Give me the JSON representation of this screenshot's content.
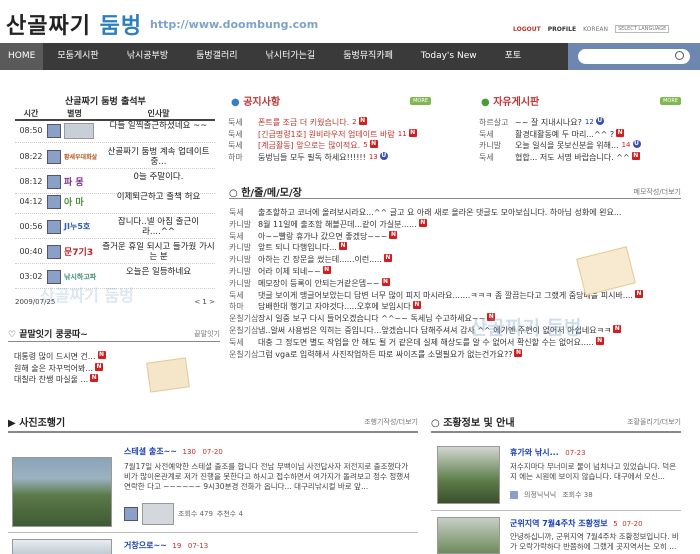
{
  "header": {
    "logo_main": "산골짜기",
    "logo_sub": "둠벙",
    "url": "http://www.doombung.com",
    "menu": {
      "logout": "LOGOUT",
      "profile": "PROFILE",
      "lang": "KOREAN",
      "select": "SELECT LANGUAGE"
    }
  },
  "nav": {
    "items": [
      "HOME",
      "모둠게시판",
      "낚시공부방",
      "둠벙갤러리",
      "낚시터가는길",
      "둠벙뮤직카페",
      "Today's New",
      "포토"
    ]
  },
  "attendance": {
    "title": "산골짜기 둠벙 출석부",
    "headers": {
      "time": "시간",
      "nick": "별명",
      "greet": "인사말"
    },
    "rows": [
      {
        "time": "08:50",
        "nick": "",
        "msg": "다들 일찍출근하셨네요 ~~"
      },
      {
        "time": "08:22",
        "nick": "황새우대화살",
        "msg": "산골짜기 둠벙 계속 업데이트중..."
      },
      {
        "time": "08:12",
        "nick": "파 몽",
        "msg": "0늘 주말이다."
      },
      {
        "time": "04:12",
        "nick": "아 마",
        "msg": "이제퇴근하고 출책 허요"
      },
      {
        "time": "00:56",
        "nick": "JI누5호",
        "msg": "잡니다..넬 아침 출근이라....^^"
      },
      {
        "time": "00:40",
        "nick": "문7기3",
        "msg": "즐거운 휴일 되시고 들가웠 가시는 분"
      },
      {
        "time": "03:02",
        "nick": "낚시하고파",
        "msg": "오늘은 일등하네요"
      }
    ],
    "date": "2009/07/25",
    "pager_prev": "<",
    "pager_next": ">",
    "pager_num": "1"
  },
  "notice": {
    "title": "공지사항",
    "more": "MORE",
    "rows": [
      {
        "cat": "둑세",
        "text": "폰트를 조금 더 키웠습니다.",
        "count": "2",
        "badge": "N"
      },
      {
        "cat": "둑세",
        "text": "[긴급명령1호] 원비라우저 업데이트 바람",
        "count": "11",
        "badge": "N"
      },
      {
        "cat": "둑세",
        "text": "[계금활동] 앞으로는 많이적요.",
        "count": "5",
        "badge": "N"
      },
      {
        "cat": "하마",
        "text": "둠벙님들 모두 필독 하세요!!!!!!",
        "count": "13",
        "badge": "U"
      }
    ]
  },
  "free": {
    "title": "자유게시판",
    "more": "MORE",
    "rows": [
      {
        "cat": "하르살고",
        "text": "~~ 잘 지내시나요?",
        "count": "12",
        "badge": "U"
      },
      {
        "cat": "둑세",
        "text": "활경대활동예 두 마리...^^ ?",
        "count": "",
        "badge": "N"
      },
      {
        "cat": "카니발",
        "text": "오늘 일식을 못보신분을 위해...",
        "count": "14",
        "badge": "U"
      },
      {
        "cat": "둑세",
        "text": "협합... 저도 서명 바랍습니다. ^^",
        "count": "",
        "badge": "N"
      }
    ]
  },
  "memo": {
    "title": "한/줄/메/모/장",
    "link": "메모작성/더보기",
    "rows": [
      {
        "cat": "둑세",
        "text": "출조할하고 코너에 올려보시라요...^^ 글고 요 아래 새로 올라온 댓글도 모아보십니다. 하아님 성화에 왼요...",
        "badge": ""
      },
      {
        "cat": "카니발",
        "text": "8월 11일에 출조함 해볼끈데...같이 가실분......",
        "badge": "N"
      },
      {
        "cat": "둑세",
        "text": "아~~빨랑 휴가나 갔으면 좋겠당~~~",
        "badge": "N"
      },
      {
        "cat": "카니발",
        "text": "앞트 되니 다행입니다...",
        "badge": "N"
      },
      {
        "cat": "카니발",
        "text": "아하는 긴 장문을 썼는데......이런.....",
        "badge": "N"
      },
      {
        "cat": "카니발",
        "text": "어라 이제 되네~~",
        "badge": "N"
      },
      {
        "cat": "카니발",
        "text": "메모장이 등록이 안되는거같은뎁~~",
        "badge": "N"
      },
      {
        "cat": "둑세",
        "text": "댓글 보이게 맹글어보았는디 답변 너무 많이 피지 마시라요.......ㅋㅋㅋ 좀 깔끔는다고 그랬게 줌당배를 피시바....",
        "badge": "N"
      },
      {
        "cat": "하마",
        "text": "담배한대 행기고 자야것다.....오후에 보입시다",
        "badge": "N"
      },
      {
        "cat": "운칠기삼",
        "text": "장시 일중 보구 다시 들어오겠습니다 ^^~~ 독세님 수고하세요~~",
        "badge": "N"
      },
      {
        "cat": "운칠기삼",
        "text": "냅..알써 사용법은 익히는 중입니다...앞겠습니다 답해주셔셔 감사 ^^ 에기엔 주현이 없어서 아쉽네요ㅋㅋ",
        "badge": "N"
      },
      {
        "cat": "둑세",
        "text": "대충 그 정도면 별도 작업을 안 해도 될 거 같은데 실제 해상도를 알 수 없어서 확신할 수는 없어요.....",
        "badge": "N"
      },
      {
        "cat": "운칠기삼",
        "text": "그럼 vga로 입력해서 사진작업하든 따로 싸이즈를 소댈필요가 없는건가요??",
        "badge": "N"
      }
    ]
  },
  "relay": {
    "title": "끝말잇기 쿵쿵따~",
    "link": "끝말잇기",
    "rows": [
      {
        "text": "대통령 많이 드시면 건...",
        "badge": "N"
      },
      {
        "text": "원해 술은 자꾸먹어봐...",
        "badge": "N"
      },
      {
        "text": "대칠라 찬쌩 마실울 ...",
        "badge": "N"
      }
    ]
  },
  "photo": {
    "title": "사진조행기",
    "link": "조행기작성/더보기",
    "items": [
      {
        "title": "스테셜 출조~~",
        "count": "130",
        "date": "07-20",
        "body": "7월17일 사전예약한 스테셜 출조를 합니다 전남 무백이님 사전답사자 저전지로 출조했다가 비가 많이온관계로 저가 진행을 못한다고 하시고 접수하면서 여가지가 돌려보고 정수 정했셔 연락한 다고 ~~~~~~ 9시30분경 전화가 옵니다... 대구리낚시컬 바로 앞...",
        "views": "조회수 479",
        "rec": "추천수 4"
      },
      {
        "title": "거창으로~~",
        "count": "19",
        "date": "07-13"
      }
    ]
  },
  "info": {
    "title": "조황정보 및 안내",
    "link": "조황올리기/더보기",
    "items": [
      {
        "title": "휴가와 낚시...",
        "date": "07-23",
        "body": "저수지마다 무너미로 물이 넘치나고 있었습니다. 덕은지 에는 시원에 보이지 않습니다. 대구에서 오신...",
        "nick": "의정닉닉닉",
        "views": "조회수 38"
      },
      {
        "title": "군위지역 7월4주차 조황정보",
        "count": "5",
        "date": "07-20",
        "body": "안녕하십니까, 군위지역 7월4주차 조황정보입니다. 비가 오락가락하다 반쯤하에 그랬게 곳지역서는 오히 ..."
      }
    ]
  },
  "watermarks": {
    "a": "산골짜기 둠벙",
    "b": "산골짜기 둠벙"
  }
}
